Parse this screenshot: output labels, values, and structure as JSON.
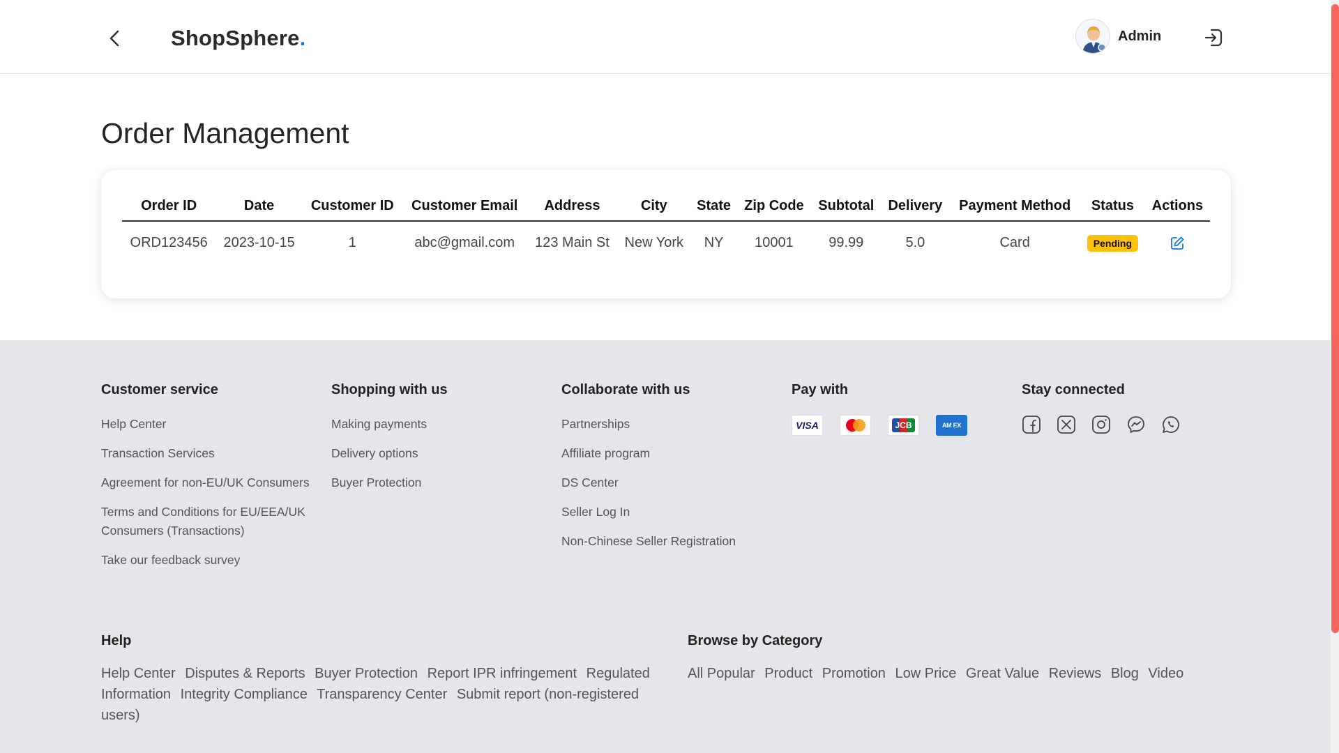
{
  "header": {
    "brand": "ShopSphere",
    "brand_dot": ".",
    "user_name": "Admin"
  },
  "main": {
    "title": "Order Management",
    "columns": [
      "Order ID",
      "Date",
      "Customer ID",
      "Customer Email",
      "Address",
      "City",
      "State",
      "Zip Code",
      "Subtotal",
      "Delivery",
      "Payment Method",
      "Status",
      "Actions"
    ],
    "rows": [
      {
        "order_id": "ORD123456",
        "date": "2023-10-15",
        "customer_id": "1",
        "email": "abc@gmail.com",
        "address": "123 Main St",
        "city": "New York",
        "state": "NY",
        "zip": "10001",
        "subtotal": "99.99",
        "delivery": "5.0",
        "payment": "Card",
        "status": "Pending"
      }
    ]
  },
  "footer": {
    "customer_service": {
      "title": "Customer service",
      "links": [
        "Help Center",
        "Transaction Services",
        "Agreement for non-EU/UK Consumers",
        "Terms and Conditions for EU/EEA/UK Consumers (Transactions)",
        "Take our feedback survey"
      ]
    },
    "shopping": {
      "title": "Shopping with us",
      "links": [
        "Making payments",
        "Delivery options",
        "Buyer Protection"
      ]
    },
    "collaborate": {
      "title": "Collaborate with us",
      "links": [
        "Partnerships",
        "Affiliate program",
        "DS Center",
        "Seller Log In",
        "Non-Chinese Seller Registration"
      ]
    },
    "pay": {
      "title": "Pay with",
      "methods": [
        "VISA",
        "Mastercard",
        "JCB",
        "AMEX"
      ],
      "visa_label": "VISA",
      "jcb_label": "JCB",
      "amex_label": "AM EX"
    },
    "connected": {
      "title": "Stay connected",
      "icons": [
        "facebook-icon",
        "x-icon",
        "instagram-icon",
        "messenger-icon",
        "whatsapp-icon"
      ]
    },
    "help": {
      "title": "Help",
      "links": [
        "Help Center",
        "Disputes & Reports",
        "Buyer Protection",
        "Report IPR infringement",
        "Regulated Information",
        "Integrity Compliance",
        "Transparency Center",
        "Submit report (non-registered users)"
      ]
    },
    "browse": {
      "title": "Browse by Category",
      "links": [
        "All Popular",
        "Product",
        "Promotion",
        "Low Price",
        "Great Value",
        "Reviews",
        "Blog",
        "Video"
      ]
    }
  },
  "colors": {
    "accent": "#1a73e8",
    "status_pending": "#ffc107",
    "footer_bg": "#e5e6ea",
    "scroll_thumb": "#f2665c"
  }
}
